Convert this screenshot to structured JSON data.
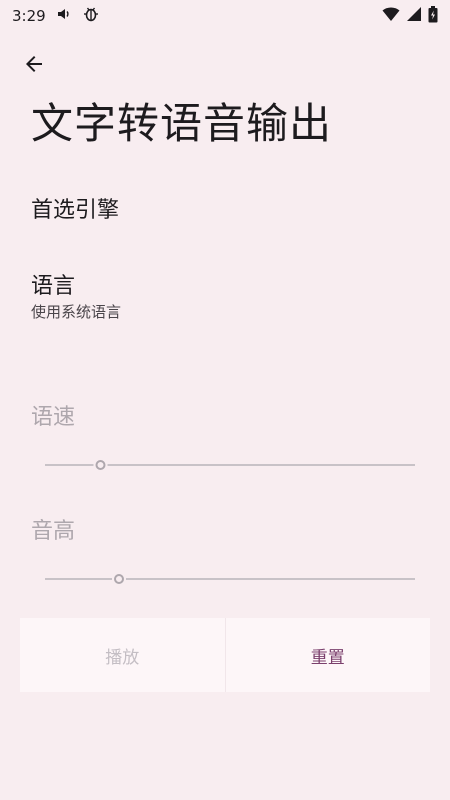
{
  "status_bar": {
    "time": "3:29"
  },
  "icons": {
    "back": "arrow-left-icon",
    "volume": "volume-icon",
    "debug": "debug-bug-icon",
    "wifi": "wifi-icon",
    "signal": "cell-signal-icon",
    "battery": "battery-icon"
  },
  "page": {
    "title": "文字转语音输出"
  },
  "preferences": {
    "engine": {
      "title": "首选引擎"
    },
    "language": {
      "title": "语言",
      "summary": "使用系统语言"
    }
  },
  "sliders": {
    "rate": {
      "label": "语速",
      "value_fraction": 0.15,
      "enabled": false
    },
    "pitch": {
      "label": "音高",
      "value_fraction": 0.2,
      "enabled": false
    }
  },
  "buttons": {
    "play_label": "播放",
    "reset_label": "重置"
  },
  "colors": {
    "background": "#f8edf0",
    "accent": "#7a3f6c",
    "disabled_text": "#aea7ad"
  }
}
